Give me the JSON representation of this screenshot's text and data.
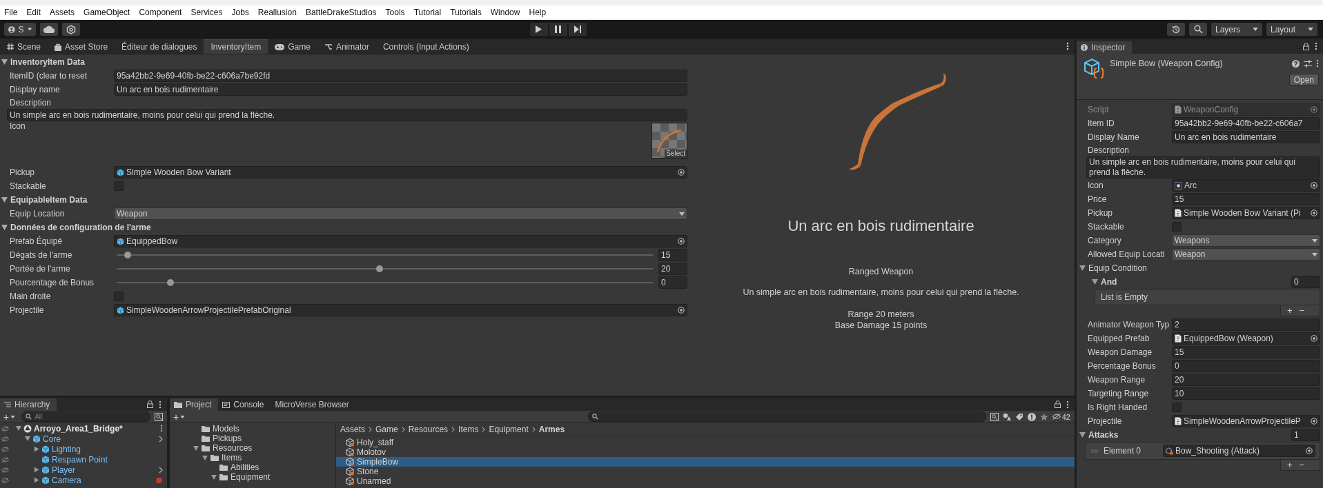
{
  "menu": [
    "File",
    "Edit",
    "Assets",
    "GameObject",
    "Component",
    "Services",
    "Jobs",
    "Reallusion",
    "BattleDrakeStudios",
    "Tools",
    "Tutorial",
    "Tutorials",
    "Window",
    "Help"
  ],
  "toolbar": {
    "account": "S",
    "layers": "Layers",
    "layout": "Layout"
  },
  "tabs": [
    {
      "label": "Scene",
      "selected": false
    },
    {
      "label": "Asset Store",
      "selected": false
    },
    {
      "label": "Éditeur de dialogues",
      "selected": false
    },
    {
      "label": "InventoryItem",
      "selected": true
    },
    {
      "label": "Game",
      "selected": false
    },
    {
      "label": "Animator",
      "selected": false
    },
    {
      "label": "Controls (Input Actions)",
      "selected": false
    }
  ],
  "editor": {
    "sections": [
      {
        "title": "InventoryItem Data",
        "expanded": true,
        "rows": [
          {
            "kind": "text",
            "label": "ItemID (clear to reset",
            "value": "95a42bb2-9e69-40fb-be22-c606a7be92fd"
          },
          {
            "kind": "text",
            "label": "Display name",
            "value": "Un arc en bois rudimentaire"
          },
          {
            "kind": "textarea",
            "label": "Description",
            "value": "Un simple arc en bois rudimentaire, moins pour celui qui prend la flèche."
          },
          {
            "kind": "sprite",
            "label": "Icon",
            "button": "Select"
          },
          {
            "kind": "object",
            "label": "Pickup",
            "value": "Simple Wooden Bow Variant"
          },
          {
            "kind": "checkbox",
            "label": "Stackable",
            "checked": false
          }
        ]
      },
      {
        "title": "EquipableItem Data",
        "expanded": true,
        "rows": [
          {
            "kind": "dropdown",
            "label": "Equip Location",
            "value": "Weapon"
          }
        ]
      },
      {
        "title": "Données de configuration de l'arme",
        "expanded": true,
        "rows": [
          {
            "kind": "object",
            "label": "Prefab Équipé",
            "value": "EquippedBow"
          },
          {
            "kind": "slider",
            "label": "Dégats de l'arme",
            "level": 0.02,
            "value": "15"
          },
          {
            "kind": "slider",
            "label": "Portée de l'arme",
            "level": 0.49,
            "value": "20"
          },
          {
            "kind": "slider",
            "label": "Pourcentage de Bonus",
            "level": 0.1,
            "value": "0"
          },
          {
            "kind": "checkbox",
            "label": "Main droite",
            "checked": false
          },
          {
            "kind": "object",
            "label": "Projectile",
            "value": "SimpleWoodenArrowProjectilePrefabOriginal"
          }
        ]
      }
    ]
  },
  "preview": {
    "title": "Un arc en bois rudimentaire",
    "type": "Ranged Weapon",
    "description": "Un simple arc en bois rudimentaire, moins pour celui qui prend la flèche.",
    "stats": [
      "Range 20 meters",
      "Base Damage 15 points"
    ]
  },
  "inspector": {
    "tab": "Inspector",
    "title": "Simple Bow (Weapon Config)",
    "open": "Open",
    "fields": [
      {
        "kind": "script",
        "label": "Script",
        "value": "WeaponConfig"
      },
      {
        "kind": "text",
        "label": "Item ID",
        "value": "95a42bb2-9e69-40fb-be22-c606a7"
      },
      {
        "kind": "text",
        "label": "Display Name",
        "value": "Un arc en bois rudimentaire"
      },
      {
        "kind": "textarea",
        "label": "Description",
        "value": "Un simple arc en bois rudimentaire, moins pour celui qui prend la flèche."
      },
      {
        "kind": "sprite",
        "label": "Icon",
        "value": "Arc"
      },
      {
        "kind": "text",
        "label": "Price",
        "value": "15"
      },
      {
        "kind": "object",
        "label": "Pickup",
        "value": "Simple Wooden Bow Variant (Pi"
      },
      {
        "kind": "checkbox",
        "label": "Stackable",
        "checked": false
      },
      {
        "kind": "dropdown",
        "label": "Category",
        "value": "Weapons"
      },
      {
        "kind": "dropdown",
        "label": "Allowed Equip Locati",
        "value": "Weapon"
      },
      {
        "kind": "foldout",
        "label": "Equip Condition",
        "expanded": true,
        "list": {
          "label": "And",
          "expanded": true,
          "count": "0",
          "empty": "List is Empty",
          "buttons": [
            "+",
            "−"
          ]
        }
      },
      {
        "kind": "text",
        "label": "Animator Weapon Typ",
        "value": "2"
      },
      {
        "kind": "object",
        "label": "Equipped Prefab",
        "value": "EquippedBow (Weapon)"
      },
      {
        "kind": "text",
        "label": "Weapon Damage",
        "value": "15"
      },
      {
        "kind": "text",
        "label": "Percentage Bonus",
        "value": "0"
      },
      {
        "kind": "text",
        "label": "Weapon Range",
        "value": "20"
      },
      {
        "kind": "text",
        "label": "Targeting Range",
        "value": "10"
      },
      {
        "kind": "checkbox",
        "label": "Is Right Handed",
        "checked": false
      },
      {
        "kind": "object",
        "label": "Projectile",
        "value": "SimpleWoodenArrowProjectileP"
      },
      {
        "kind": "array",
        "label": "Attacks",
        "expanded": true,
        "count": "1",
        "elements": [
          {
            "label": "Element 0",
            "value": "Bow_Shooting (Attack)"
          }
        ],
        "buttons": [
          "+",
          "−"
        ]
      }
    ]
  },
  "hierarchy": {
    "tab": "Hierarchy",
    "add": "+",
    "placeholder": "All",
    "tree": [
      {
        "label": "Arroyo_Area1_Bridge*",
        "kind": "scene",
        "expanded": true,
        "children": [
          {
            "label": "Core",
            "kind": "prefab",
            "expanded": true,
            "open_arrow": true,
            "children": [
              {
                "label": "Lighting",
                "kind": "prefab",
                "expanded": false
              },
              {
                "label": "Respawn Point",
                "kind": "prefab"
              },
              {
                "label": "Player",
                "kind": "prefab",
                "expanded": false,
                "open_arrow": true
              },
              {
                "label": "Camera",
                "kind": "prefab",
                "expanded": false,
                "warning": true
              }
            ]
          }
        ]
      }
    ]
  },
  "project": {
    "tabs": [
      {
        "label": "Project",
        "selected": true
      },
      {
        "label": "Console",
        "selected": false
      },
      {
        "label": "MicroVerse Browser",
        "selected": false
      }
    ],
    "add": "+",
    "hidden_count": "42",
    "folders": [
      {
        "label": "Models"
      },
      {
        "label": "Pickups"
      },
      {
        "label": "Resources",
        "expanded": true,
        "children": [
          {
            "label": "Items",
            "expanded": true,
            "children": [
              {
                "label": "Abilities"
              },
              {
                "label": "Equipment",
                "expanded": true
              }
            ]
          }
        ]
      }
    ],
    "breadcrumb": [
      "Assets",
      "Game",
      "Resources",
      "Items",
      "Equipment",
      "Armes"
    ],
    "files": [
      {
        "label": "Holy_staff",
        "selected": false
      },
      {
        "label": "Molotov",
        "selected": false
      },
      {
        "label": "SimpleBow",
        "selected": true
      },
      {
        "label": "Stone",
        "selected": false
      },
      {
        "label": "Unarmed",
        "selected": false
      }
    ]
  }
}
